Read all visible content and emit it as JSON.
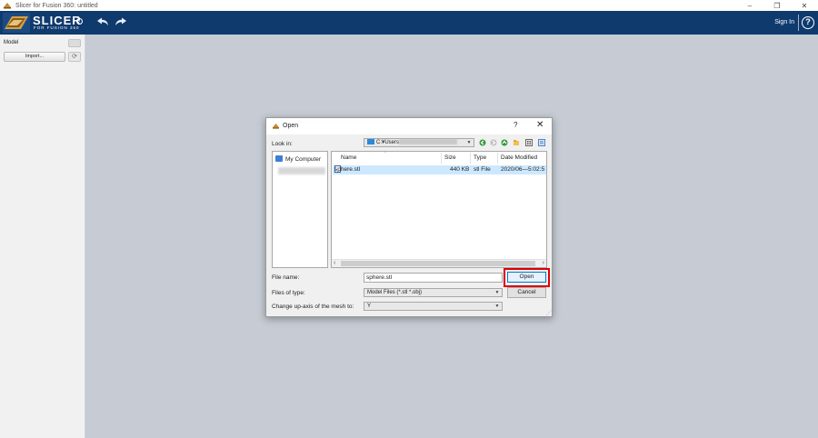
{
  "window": {
    "title": "Slicer for Fusion 360: untitled",
    "minimize": "–",
    "restore": "❐",
    "close": "✕"
  },
  "header": {
    "brand_name": "SLICER",
    "brand_sub": "FOR FUSION 360",
    "info": "i",
    "sign_in": "Sign In",
    "help": "?",
    "color": "#0f3a6e"
  },
  "left_panel": {
    "model_label": "Model",
    "import_label": "Import...",
    "refresh": "⟳"
  },
  "dialog": {
    "title": "Open",
    "help": "?",
    "close": "✕",
    "look_in_label": "Look in:",
    "look_in_value": "C:¥Users",
    "places": {
      "my_computer": "My Computer"
    },
    "columns": {
      "name": "Name",
      "size": "Size",
      "type": "Type",
      "date_modified": "Date Modified"
    },
    "files": [
      {
        "name": "sphere.stl",
        "size": "440 KB",
        "type": "stl File",
        "date": "2020/06—5:02:5"
      }
    ],
    "file_name_label": "File name:",
    "file_name_value": "sphere.stl",
    "files_of_type_label": "Files of type:",
    "files_of_type_value": "Model Files (*.stl *.obj)",
    "up_axis_label": "Change up-axis of the mesh to:",
    "up_axis_value": "Y",
    "open_button": "Open",
    "cancel_button": "Cancel"
  },
  "highlight_color": "#e00000",
  "icons": [
    "app-icon",
    "undo-icon",
    "redo-icon",
    "info-icon",
    "help-icon",
    "eye-icon",
    "refresh-icon",
    "folder-icon",
    "back-icon",
    "forward-icon",
    "up-folder-icon",
    "new-folder-icon",
    "list-view-icon",
    "detail-view-icon",
    "computer-icon",
    "stl-file-icon"
  ]
}
